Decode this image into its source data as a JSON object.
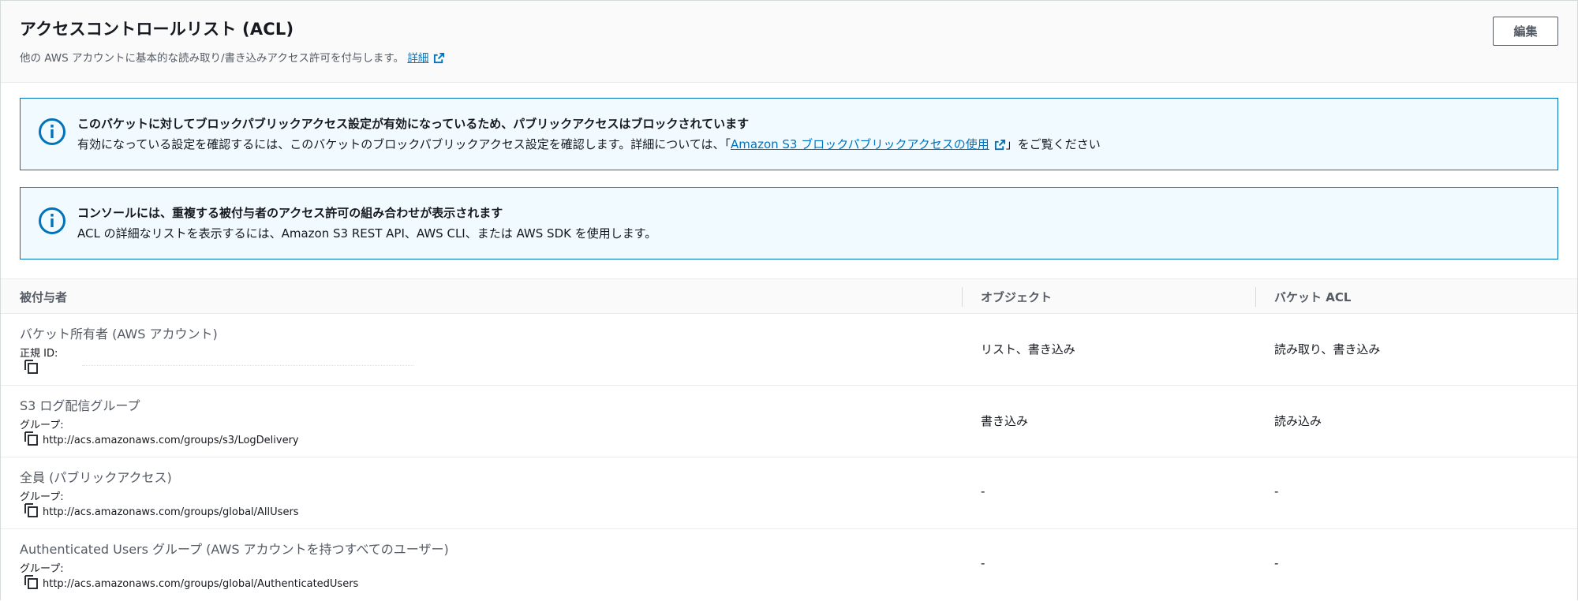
{
  "header": {
    "title": "アクセスコントロールリスト (ACL)",
    "description": "他の AWS アカウントに基本的な読み取り/書き込みアクセス許可を付与します。",
    "details_link": "詳細",
    "edit_button": "編集"
  },
  "alerts": [
    {
      "title": "このバケットに対してブロックパブリックアクセス設定が有効になっているため、パブリックアクセスはブロックされています",
      "body_prefix": "有効になっている設定を確認するには、このバケットのブロックパブリックアクセス設定を確認します。詳細については、「",
      "link": "Amazon S3 ブロックパブリックアクセスの使用",
      "body_suffix": "」をご覧ください"
    },
    {
      "title": "コンソールには、重複する被付与者のアクセス許可の組み合わせが表示されます",
      "body": "ACL の詳細なリストを表示するには、Amazon S3 REST API、AWS CLI、または AWS SDK を使用します。"
    }
  ],
  "table": {
    "columns": [
      "被付与者",
      "オブジェクト",
      "バケット ACL"
    ],
    "rows": [
      {
        "name": "バケット所有者 (AWS アカウント)",
        "label": "正規 ID:",
        "id": "",
        "object": "リスト、書き込み",
        "bucket_acl": "読み取り、書き込み"
      },
      {
        "name": "S3 ログ配信グループ",
        "label": "グループ:",
        "id": "http://acs.amazonaws.com/groups/s3/LogDelivery",
        "object": "書き込み",
        "bucket_acl": "読み込み"
      },
      {
        "name": "全員 (パブリックアクセス)",
        "label": "グループ:",
        "id": "http://acs.amazonaws.com/groups/global/AllUsers",
        "object": "-",
        "bucket_acl": "-"
      },
      {
        "name": "Authenticated Users グループ (AWS アカウントを持つすべてのユーザー)",
        "label": "グループ:",
        "id": "http://acs.amazonaws.com/groups/global/AuthenticatedUsers",
        "object": "-",
        "bucket_acl": "-"
      }
    ]
  },
  "icons": {
    "info": "info-circle-icon",
    "external": "external-link-icon",
    "copy": "copy-icon"
  },
  "colors": {
    "accent": "#0073bb",
    "alert_bg": "#f1faff",
    "text": "#16191f",
    "muted": "#545b64"
  }
}
